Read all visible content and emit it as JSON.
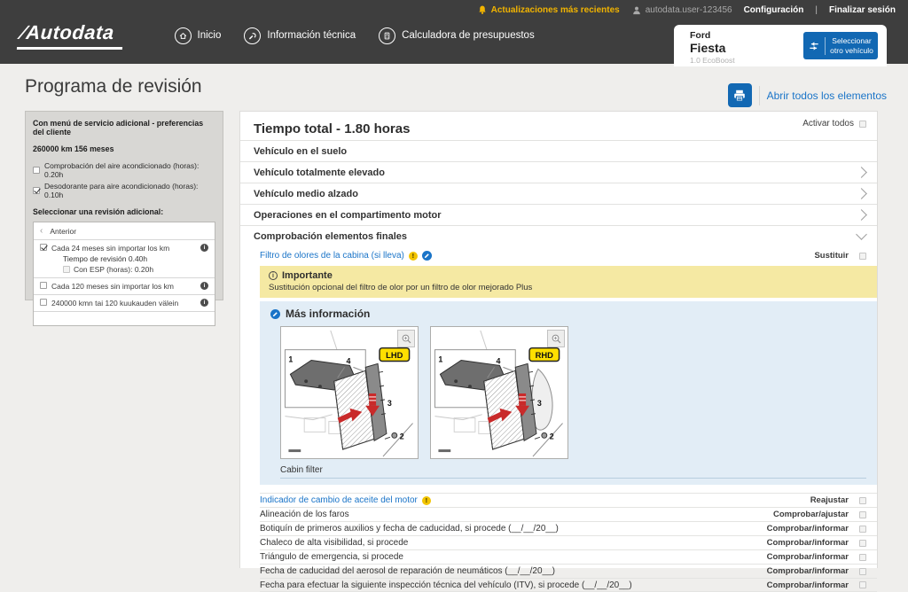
{
  "colors": {
    "topbar_bg": "#3e3e3e",
    "accent_blue": "#1268b3",
    "link_blue": "#1a74c8",
    "updates_yellow": "#f2b400",
    "important_box_yellow": "#f5e9a3",
    "info_box_blue": "#e2edf6",
    "badge_yellow": "#ffdf00"
  },
  "topbar": {
    "logo_text": "Autodata",
    "nav": [
      {
        "label": "Inicio"
      },
      {
        "label": "Información técnica"
      },
      {
        "label": "Calculadora de presupuestos"
      }
    ],
    "updates_label": "Actualizaciones más recientes",
    "username": "autodata.user-123456",
    "settings_label": "Configuración",
    "divider": "|",
    "logout_label": "Finalizar sesión"
  },
  "vehicle": {
    "make": "Ford",
    "model": "Fiesta",
    "variant": "1.0 EcoBoost",
    "select_button": "Seleccionar otro vehículo"
  },
  "page": {
    "title": "Programa de revisión",
    "open_all_label": "Abrir todos los elementos"
  },
  "sidebar": {
    "heading": "Con menú de servicio adicional - preferencias del cliente",
    "mileage": "260000 km 156 meses",
    "options": [
      {
        "label": "Comprobación del aire acondicionado (horas): 0.20h",
        "checked": false
      },
      {
        "label": "Desodorante para aire acondicionado (horas): 0.10h",
        "checked": true
      }
    ],
    "select_heading": "Seleccionar una revisión adicional:",
    "back_label": "Anterior",
    "revisions": [
      {
        "label": "Cada 24 meses sin importar los km",
        "checked": true,
        "time": "Tiempo de revisión 0.40h",
        "sub_option": "Con ESP (horas): 0.20h",
        "sub_checked": false
      },
      {
        "label": "Cada 120 meses sin importar los km",
        "checked": false
      },
      {
        "label": "240000 kmn tai 120 kuukauden välein",
        "checked": false
      }
    ]
  },
  "main": {
    "total_time": "Tiempo total - 1.80 horas",
    "activate_all": "Activar todos",
    "activate_all_checked": false,
    "sections": [
      {
        "label": "Vehículo en el suelo",
        "chevron": "none"
      },
      {
        "label": "Vehículo totalmente elevado",
        "chevron": "right"
      },
      {
        "label": "Vehículo medio alzado",
        "chevron": "right"
      },
      {
        "label": "Operaciones en el compartimento motor",
        "chevron": "right"
      },
      {
        "label": "Comprobación elementos finales",
        "chevron": "down"
      }
    ],
    "filter_task": {
      "label": "Filtro de olores de la cabina (si lleva)",
      "action": "Sustituir",
      "checked": false
    },
    "important": {
      "title": "Importante",
      "text": "Sustitución opcional del filtro de olor por un filtro de olor mejorado Plus"
    },
    "more_info": {
      "title": "Más información",
      "caption": "Cabin filter"
    },
    "figures": [
      {
        "badge": "LHD"
      },
      {
        "badge": "RHD"
      }
    ],
    "figure_callouts": {
      "c1": "1",
      "c2": "2",
      "c3": "3",
      "c4": "4"
    },
    "tasks": [
      {
        "label": "Indicador de cambio de aceite del motor",
        "action": "Reajustar",
        "checked": false
      },
      {
        "label": "Alineación de los faros",
        "action": "Comprobar/ajustar",
        "checked": false
      },
      {
        "label": "Botiquín de primeros auxilios y fecha de caducidad, si procede (__/__/20__)",
        "action": "Comprobar/informar",
        "checked": false
      },
      {
        "label": "Chaleco de alta visibilidad, si procede",
        "action": "Comprobar/informar",
        "checked": false
      },
      {
        "label": "Triángulo de emergencia, si procede",
        "action": "Comprobar/informar",
        "checked": false
      },
      {
        "label": "Fecha de caducidad del aerosol de reparación de neumáticos (__/__/20__)",
        "action": "Comprobar/informar",
        "checked": false
      },
      {
        "label": "Fecha para efectuar la siguiente inspección técnica del vehículo (ITV), si procede (__/__/20__)",
        "action": "Comprobar/informar",
        "checked": false
      }
    ]
  }
}
